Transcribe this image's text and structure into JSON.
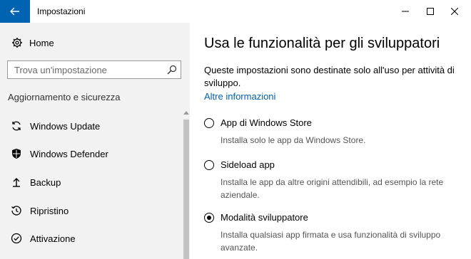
{
  "window": {
    "title": "Impostazioni",
    "controls": {
      "minimize": "minimize-icon",
      "maximize": "maximize-icon",
      "close": "close-icon"
    }
  },
  "sidebar": {
    "home_label": "Home",
    "search_placeholder": "Trova un'impostazione",
    "section_title": "Aggiornamento e sicurezza",
    "items": [
      {
        "label": "Windows Update",
        "icon": "sync-icon"
      },
      {
        "label": "Windows Defender",
        "icon": "shield-icon"
      },
      {
        "label": "Backup",
        "icon": "backup-arrow-icon"
      },
      {
        "label": "Ripristino",
        "icon": "history-icon"
      },
      {
        "label": "Attivazione",
        "icon": "check-circle-icon"
      }
    ]
  },
  "main": {
    "title": "Usa le funzionalità per gli sviluppatori",
    "description": "Queste impostazioni sono destinate solo all'uso per attività di sviluppo.",
    "more_info": "Altre informazioni",
    "options": [
      {
        "label": "App di Windows Store",
        "description": "Installa solo le app da Windows Store.",
        "selected": false
      },
      {
        "label": "Sideload app",
        "description": "Installa le app da altre origini attendibili, ad esempio la rete aziendale.",
        "selected": false
      },
      {
        "label": "Modalità sviluppatore",
        "description": "Installa qualsiasi app firmata e usa funzionalità di sviluppo avanzate.",
        "selected": true
      }
    ]
  },
  "colors": {
    "accent": "#0063b1",
    "sidebar_bg": "#f2f2f2"
  }
}
